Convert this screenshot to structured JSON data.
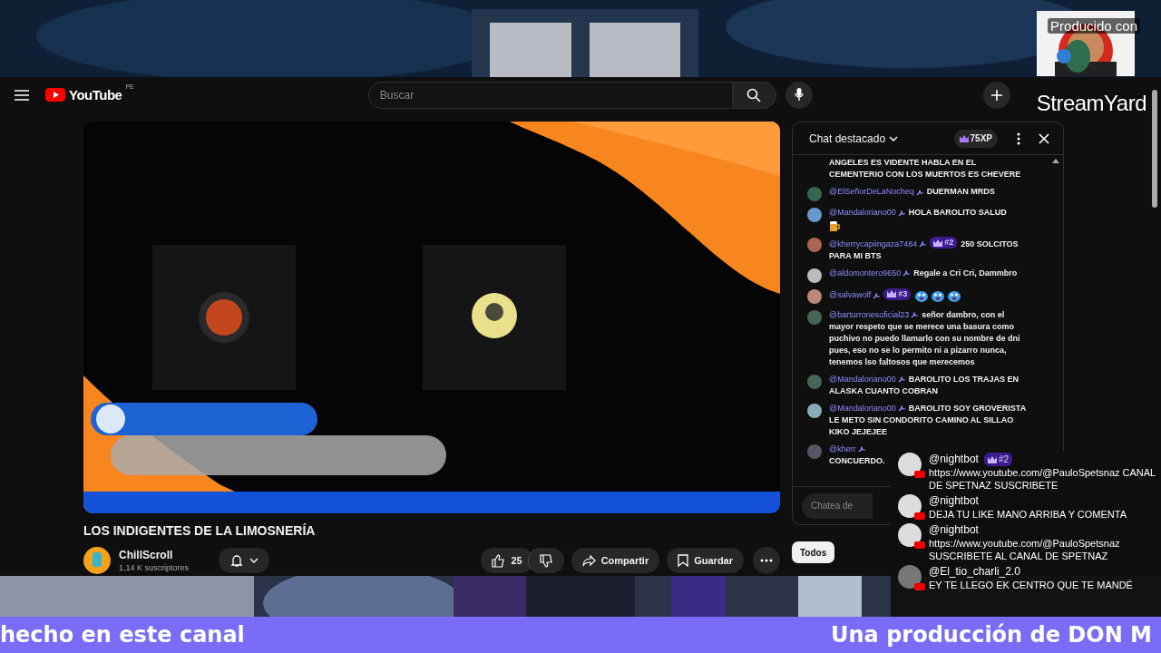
{
  "stream_badge": {
    "label": "Producido con",
    "brand": "StreamYard"
  },
  "header": {
    "logo": "YouTube",
    "region": "PE",
    "search": {
      "placeholder": "Buscar"
    }
  },
  "title": "LOS INDIGENTES DE LA LIMOSNERÍA",
  "channel": {
    "name": "ChillScroll",
    "subscribers": "1,14 K suscriptores"
  },
  "actions": {
    "likes": "25",
    "share": "Compartir",
    "save": "Guardar"
  },
  "chat": {
    "title": "Chat destacado",
    "xp": "75XP",
    "messages": [
      {
        "kind": "plain",
        "text": "ANGELES ES VIDENTE HABLA EN EL CEMENTERIO CON LOS MUERTOS ES CHEVERE"
      },
      {
        "kind": "plain",
        "author": "@ElSeñorDeLaNocheq",
        "text": "DUERMAN MRDS"
      },
      {
        "kind": "with_emote",
        "author": "@Mandaloriano00",
        "text": "HOLA BAROLITO SALUD"
      },
      {
        "kind": "plain",
        "author": "@kherrycapiingaza7484",
        "rank": "#2",
        "text": "250 SOLCITOS PARA MI BTS"
      },
      {
        "kind": "plain",
        "author": "@aldomontero9650",
        "text": "Regale a Cri Cri, Dammbro"
      },
      {
        "kind": "emote_only",
        "author": "@salvawolf",
        "rank": "#3"
      },
      {
        "kind": "plain",
        "author": "@barturronesoficial23",
        "text": "señor dambro, con el mayor respeto que se merece una basura como puchivo no puedo llamarlo con su nombre de dni pues, eso no se lo permito ni a pizarro nunca, tenemos lso faltosos que merecemos"
      },
      {
        "kind": "plain",
        "author": "@Mandaloriano00",
        "text": "BAROLITO LOS TRAJAS EN ALASKA CUANTO COBRAN"
      },
      {
        "kind": "plain",
        "author": "@Mandaloriano00",
        "text": "BAROLITO SOY GROVERISTA LE METO SIN CONDORITO CAMINO AL SILLAO KIKO JEJEJEE"
      },
      {
        "kind": "clipped",
        "author": "@kherr",
        "text": "CONCUERDO."
      }
    ],
    "input": {
      "placeholder": "Chatea de"
    },
    "filters": [
      {
        "label": "Todos",
        "selected": true
      }
    ]
  },
  "overlay_chat": [
    {
      "author": "@nightbot",
      "rank": "#2",
      "text": "https://www.youtube.com/@PauloSpetsnaz CANAL DE SPETNAZ SUSCRIBETE"
    },
    {
      "author": "@nightbot",
      "text": "DEJA TU LIKE MANO ARRIBA Y COMENTA"
    },
    {
      "author": "@nightbot",
      "text": "https://www.youtube.com/@PauloSpetsnaz SUSCRIBETE AL CANAL DE SPETNAZ"
    },
    {
      "author": "@El_tio_charli_2.0",
      "text": "EY TE LLEGO EK CENTRO QUE TE MANDÉ"
    }
  ],
  "ticker": {
    "left": "hecho en este canal",
    "right": "Una producción de DON M"
  }
}
